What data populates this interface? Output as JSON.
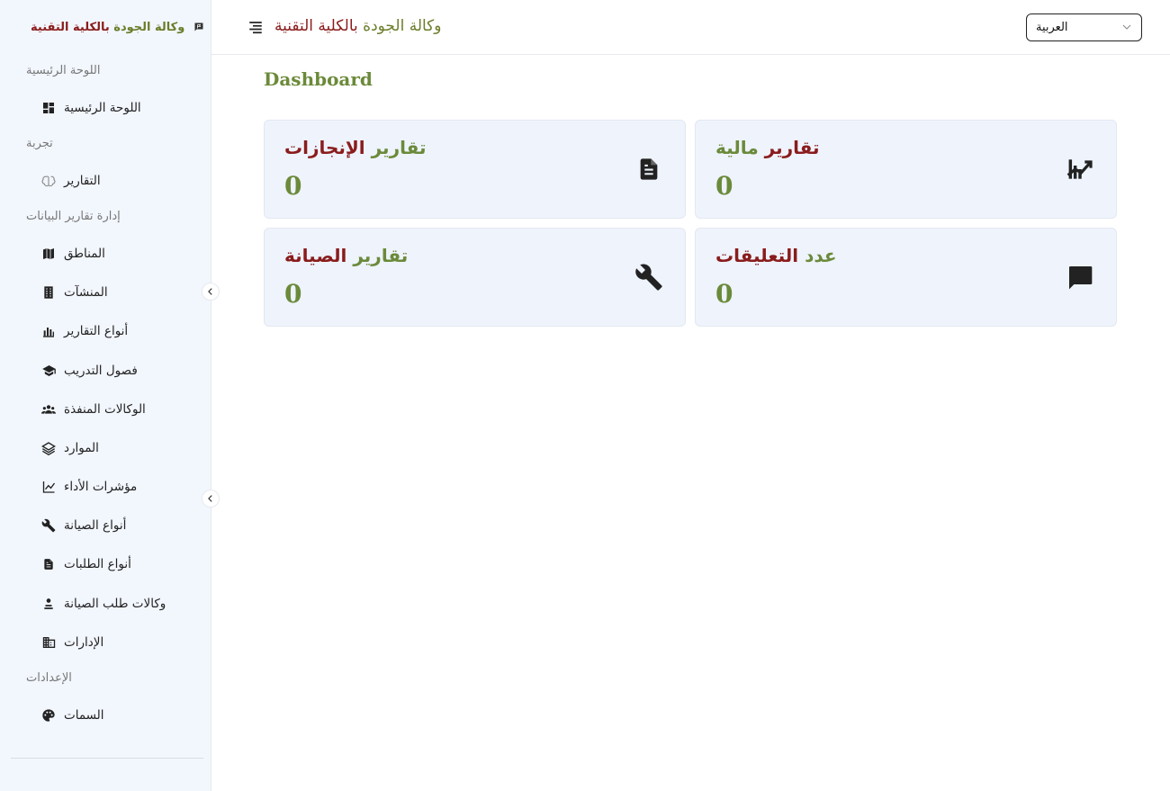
{
  "brand": {
    "title_part1": "وكالة الجودة",
    "title_part2": " بالكلية التقنية",
    "icon": "flag-message-icon"
  },
  "header": {
    "title_part1": "وكالة الجودة",
    "title_part2": " بالكلية التقنية",
    "menu_icon": "menu-align-icon"
  },
  "language_select": {
    "value": "العربية"
  },
  "sidebar": {
    "sections": [
      {
        "title": "اللوحة الرئيسية"
      },
      {
        "title": "تجربة"
      },
      {
        "title": "إدارة تقارير البيانات"
      },
      {
        "title": "الإعدادات"
      }
    ],
    "items": [
      {
        "label": "اللوحة الرئيسية",
        "icon": "dashboard-icon"
      },
      {
        "label": "التقارير",
        "icon": "brain-icon"
      },
      {
        "label": "المناطق",
        "icon": "map-icon"
      },
      {
        "label": "المنشآت",
        "icon": "building-icon"
      },
      {
        "label": "أنواع التقارير",
        "icon": "bar-chart-icon"
      },
      {
        "label": "فصول التدريب",
        "icon": "graduation-cap-icon"
      },
      {
        "label": "الوكالات المنفذة",
        "icon": "group-icon"
      },
      {
        "label": "الموارد",
        "icon": "layers-icon"
      },
      {
        "label": "مؤشرات الأداء",
        "icon": "line-chart-icon"
      },
      {
        "label": "أنواع الصيانة",
        "icon": "wrench-icon"
      },
      {
        "label": "أنواع الطلبات",
        "icon": "document-icon"
      },
      {
        "label": "وكالات طلب الصيانة",
        "icon": "person-icon"
      },
      {
        "label": "الإدارات",
        "icon": "corporate-icon"
      },
      {
        "label": "السمات",
        "icon": "palette-icon"
      }
    ]
  },
  "page": {
    "title": "Dashboard"
  },
  "cards": [
    {
      "title_a": "تقارير ",
      "title_b": "الإنجازات",
      "value": "0",
      "icon": "document-icon"
    },
    {
      "title_a": "تقارير ",
      "title_b": "مالية",
      "value": "0",
      "icon": "trending-chart-icon"
    },
    {
      "title_a": "تقارير ",
      "title_b": "الصيانة",
      "value": "0",
      "icon": "wrench-icon"
    },
    {
      "title_a": "عدد ",
      "title_b": "التعليقات",
      "value": "0",
      "icon": "chat-icon"
    }
  ],
  "colors": {
    "green": "#6b8a3a",
    "red": "#8a1c1c",
    "card_bg": "#eef3fc",
    "sidebar_bg": "#f2f6fd"
  }
}
